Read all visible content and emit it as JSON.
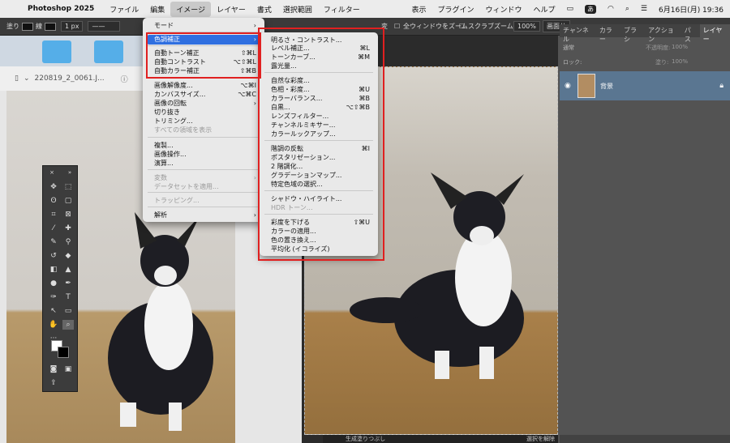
{
  "menubar": {
    "app_name": "Photoshop 2025",
    "items": [
      "ファイル",
      "編集",
      "イメージ",
      "レイヤー",
      "書式",
      "選択範囲",
      "フィルター"
    ],
    "right_items": [
      "表示",
      "プラグイン",
      "ウィンドウ",
      "ヘルプ"
    ],
    "input_badge": "あ",
    "datetime": "6月16日(月)  19:36"
  },
  "optbar": {
    "fill_label": "塗り",
    "stroke_label": "線",
    "stroke_width": "1 px",
    "all_windows_label": "全ウィンドウをズーム",
    "scrubby_label": "スクラブズーム",
    "zoom_value": "100%",
    "fit_button": "画面サ",
    "cut_label": "変"
  },
  "document": {
    "tab_title": "220819_2_0061.J...",
    "app_title_fragment": "Ado"
  },
  "panel": {
    "tabs": [
      "チャンネル",
      "カラー",
      "ブラシ",
      "アクション",
      "パス",
      "レイヤー"
    ],
    "blend_mode": "通常",
    "opacity_label": "不透明度:",
    "opacity_value": "100%",
    "lock_label": "ロック:",
    "fill_label": "塗り:",
    "fill_value": "100%",
    "layer_name": "背景"
  },
  "image_menu": {
    "items": [
      {
        "label": "モード",
        "submenu": true
      },
      {
        "label": "色調補正",
        "submenu": true,
        "selected": true
      },
      {
        "label": "自動トーン補正",
        "shortcut": "⇧⌘L"
      },
      {
        "label": "自動コントラスト",
        "shortcut": "⌥⇧⌘L"
      },
      {
        "label": "自動カラー補正",
        "shortcut": "⇧⌘B"
      },
      {
        "label": "画像解像度...",
        "shortcut": "⌥⌘I"
      },
      {
        "label": "カンバスサイズ...",
        "shortcut": "⌥⌘C"
      },
      {
        "label": "画像の回転",
        "submenu": true
      },
      {
        "label": "切り抜き"
      },
      {
        "label": "トリミング..."
      },
      {
        "label": "すべての領域を表示",
        "disabled": true
      },
      {
        "label": "複製..."
      },
      {
        "label": "画像操作..."
      },
      {
        "label": "演算..."
      },
      {
        "label": "変数",
        "submenu": true,
        "disabled": true
      },
      {
        "label": "データセットを適用...",
        "disabled": true
      },
      {
        "label": "トラッピング...",
        "disabled": true
      },
      {
        "label": "解析",
        "submenu": true
      }
    ]
  },
  "adjust_menu": {
    "items": [
      {
        "label": "明るさ・コントラスト..."
      },
      {
        "label": "レベル補正...",
        "shortcut": "⌘L"
      },
      {
        "label": "トーンカーブ...",
        "shortcut": "⌘M"
      },
      {
        "label": "露光量..."
      },
      {
        "label": "自然な彩度..."
      },
      {
        "label": "色相・彩度...",
        "shortcut": "⌘U"
      },
      {
        "label": "カラーバランス...",
        "shortcut": "⌘B"
      },
      {
        "label": "白黒...",
        "shortcut": "⌥⇧⌘B"
      },
      {
        "label": "レンズフィルター..."
      },
      {
        "label": "チャンネルミキサー..."
      },
      {
        "label": "カラールックアップ..."
      },
      {
        "label": "階調の反転",
        "shortcut": "⌘I"
      },
      {
        "label": "ポスタリゼーション..."
      },
      {
        "label": "2 階調化..."
      },
      {
        "label": "グラデーションマップ..."
      },
      {
        "label": "特定色域の選択..."
      },
      {
        "label": "シャドウ・ハイライト..."
      },
      {
        "label": "HDR トーン...",
        "disabled": true
      },
      {
        "label": "彩度を下げる",
        "shortcut": "⇧⌘U"
      },
      {
        "label": "カラーの適用..."
      },
      {
        "label": "色の置き換え..."
      },
      {
        "label": "平均化 (イコライズ)"
      }
    ]
  },
  "context_bar": {
    "label": "生成塗りつぶし",
    "deselect": "選択を解除"
  },
  "colors": {
    "highlight": "#2f6fe0",
    "annotation_red": "#e02020",
    "layer_selected": "#5a7691"
  }
}
